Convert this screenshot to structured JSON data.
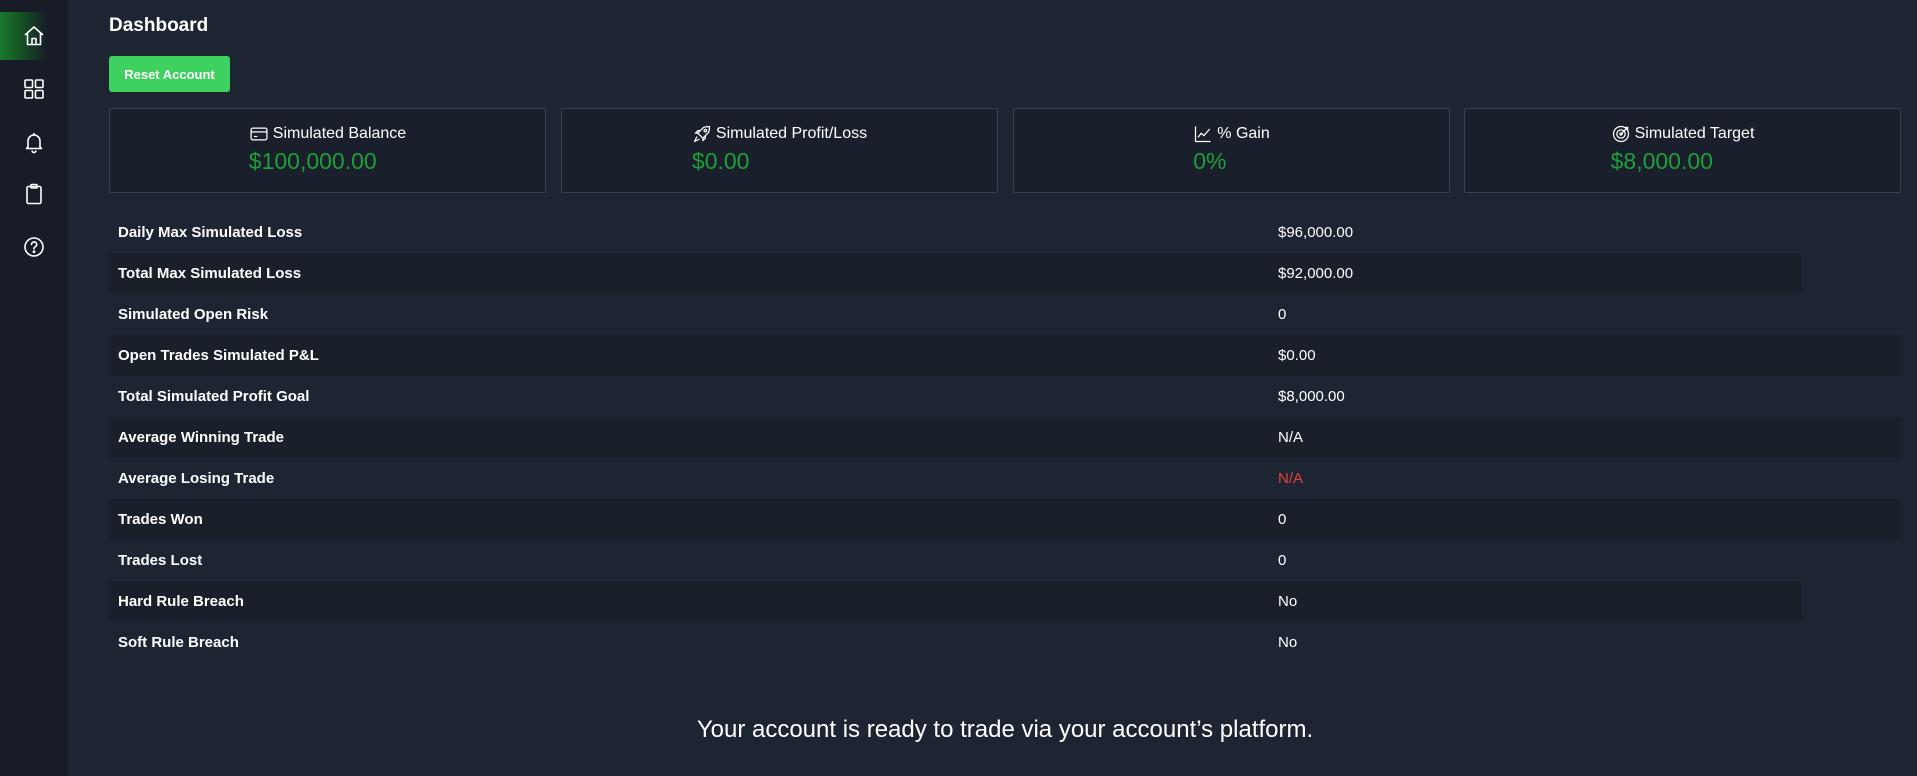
{
  "header": {
    "title": "Dashboard"
  },
  "actions": {
    "reset_label": "Reset Account"
  },
  "sidebar": {
    "items": [
      {
        "icon": "home-icon",
        "active": true
      },
      {
        "icon": "grid-icon",
        "active": false
      },
      {
        "icon": "bell-icon",
        "active": false
      },
      {
        "icon": "clipboard-icon",
        "active": false
      },
      {
        "icon": "help-icon",
        "active": false
      }
    ]
  },
  "cards": [
    {
      "label": "Simulated Balance",
      "value": "$100,000.00",
      "icon": "card-icon"
    },
    {
      "label": "Simulated Profit/Loss",
      "value": "$0.00",
      "icon": "rocket-icon"
    },
    {
      "label": "% Gain",
      "value": "0%",
      "icon": "chart-line-icon"
    },
    {
      "label": "Simulated Target",
      "value": "$8,000.00",
      "icon": "target-icon"
    }
  ],
  "stats": [
    {
      "label": "Daily Max Simulated Loss",
      "value": "$96,000.00"
    },
    {
      "label": "Total Max Simulated Loss",
      "value": "$92,000.00"
    },
    {
      "label": "Simulated Open Risk",
      "value": "0"
    },
    {
      "label": "Open Trades Simulated P&L",
      "value": "$0.00"
    },
    {
      "label": "Total Simulated Profit Goal",
      "value": "$8,000.00"
    },
    {
      "label": "Average Winning Trade",
      "value": "N/A"
    },
    {
      "label": "Average Losing Trade",
      "value": "N/A"
    },
    {
      "label": "Trades Won",
      "value": "0"
    },
    {
      "label": "Trades Lost",
      "value": "0"
    },
    {
      "label": "Hard Rule Breach",
      "value": "No"
    },
    {
      "label": "Soft Rule Breach",
      "value": "No"
    }
  ],
  "footer": {
    "message": "Your account is ready to trade via your account’s platform."
  },
  "colors": {
    "accent": "#3fd15f",
    "positive": "#1f9e39",
    "negative": "#e8413c",
    "background": "#1e2532",
    "sidebar": "#171c26"
  }
}
